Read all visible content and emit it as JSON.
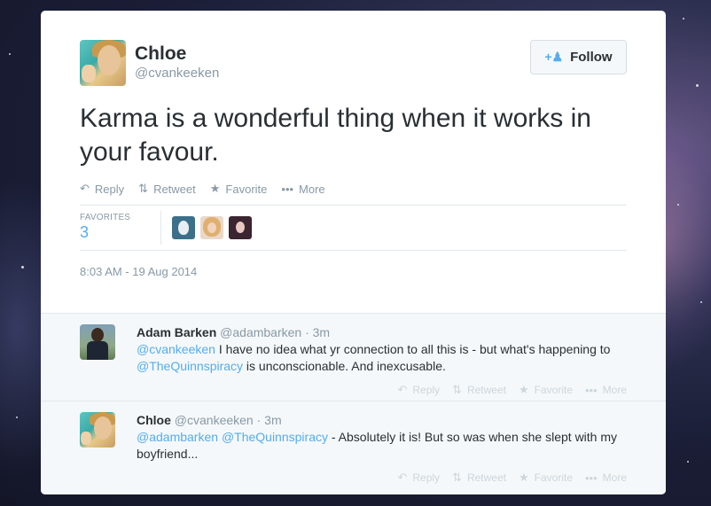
{
  "tweet": {
    "author_name": "Chloe",
    "author_handle": "@cvankeeken",
    "follow_label": "Follow",
    "text": "Karma is a wonderful thing when it works in your favour.",
    "actions": {
      "reply": "Reply",
      "retweet": "Retweet",
      "favorite": "Favorite",
      "more": "More"
    },
    "favorites_label": "FAVORITES",
    "favorites_count": "3",
    "timestamp": "8:03 AM - 19 Aug 2014"
  },
  "replies": [
    {
      "name": "Adam Barken",
      "handle": "@adambarken",
      "time": "· 3m",
      "parts": [
        {
          "t": "@cvankeeken",
          "m": true
        },
        {
          "t": " I have no idea what yr connection to all this is - but what's happening to ",
          "m": false
        },
        {
          "t": "@TheQuinnspiracy",
          "m": true
        },
        {
          "t": "  is unconscionable. And inexcusable.",
          "m": false
        }
      ],
      "actions": {
        "reply": "Reply",
        "retweet": "Retweet",
        "favorite": "Favorite",
        "more": "More"
      }
    },
    {
      "name": "Chloe",
      "handle": "@cvankeeken",
      "time": "· 3m",
      "parts": [
        {
          "t": "@adambarken",
          "m": true
        },
        {
          "t": " ",
          "m": false
        },
        {
          "t": "@TheQuinnspiracy",
          "m": true
        },
        {
          "t": " -  Absolutely it is!  But so was when she slept with my boyfriend...",
          "m": false
        }
      ],
      "actions": {
        "reply": "Reply",
        "retweet": "Retweet",
        "favorite": "Favorite",
        "more": "More"
      }
    }
  ],
  "colors": {
    "accent": "#55acee",
    "text": "#292f33",
    "muted": "#8899a6"
  },
  "icons": {
    "follow": "add-user-icon",
    "reply": "reply-arrow-icon",
    "retweet": "retweet-icon",
    "favorite": "star-icon",
    "more": "dots-icon"
  }
}
